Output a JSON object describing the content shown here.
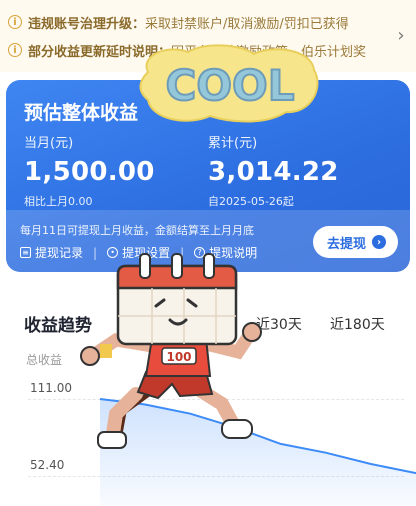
{
  "notices": [
    {
      "title": "违规账号治理升级：",
      "text": "采取封禁账户/取消激励/罚扣已获得"
    },
    {
      "title": "部分收益更新延时说明：",
      "text": "因平台补贴激励政策，伯乐计划奖"
    }
  ],
  "earnings": {
    "title": "预估整体收益",
    "month_label": "当月(元)",
    "month_value": "1,500.00",
    "month_compare": "相比上月0.00",
    "total_label": "累计(元)",
    "total_value": "3,014.22",
    "total_since": "自2025-05-26起",
    "withdraw_tip": "每月11日可提现上月收益，金额结算至上月月底",
    "links": [
      "提现记录",
      "提现设置",
      "提现说明"
    ],
    "withdraw_button": "去提现"
  },
  "trend": {
    "title": "收益趋势",
    "tabs": [
      "近30天",
      "近180天"
    ],
    "y_unit": "总收益",
    "y_ticks": [
      "111.00",
      "52.40"
    ]
  },
  "chart_data": {
    "type": "line",
    "series": [
      {
        "values": [
          111.0,
          105.0,
          95.0,
          80.0,
          62.0,
          52.4,
          40.0,
          30.0
        ]
      }
    ],
    "ylim": [
      0,
      111.0
    ]
  },
  "decorations": {
    "sticker_text": "COOL",
    "mascot_shirt_number": "100"
  },
  "colors": {
    "brand_blue": "#2c6de0",
    "notice_gold": "#d9a23a",
    "line_blue": "#3d8bf7"
  }
}
